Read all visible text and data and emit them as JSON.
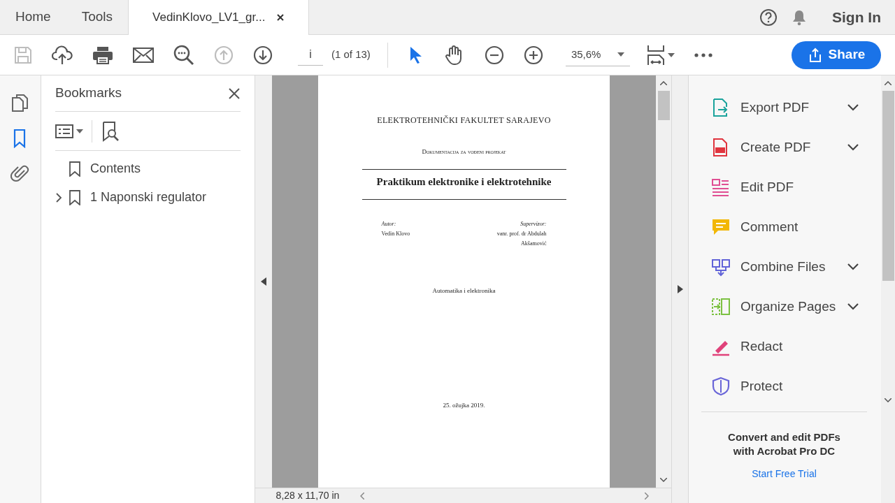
{
  "tabs": [
    {
      "label": "Home",
      "selected": false,
      "closable": false
    },
    {
      "label": "Tools",
      "selected": false,
      "closable": false
    },
    {
      "label": "VedinKlovo_LV1_gr...",
      "selected": true,
      "closable": true
    }
  ],
  "header": {
    "sign_in": "Sign In"
  },
  "toolbar": {
    "tools": [
      {
        "kind": "save",
        "disabled": true
      },
      {
        "kind": "upload",
        "disabled": false
      },
      {
        "kind": "print",
        "disabled": false
      },
      {
        "kind": "email",
        "disabled": false
      },
      {
        "kind": "find",
        "disabled": false
      },
      {
        "kind": "prev",
        "disabled": true
      },
      {
        "kind": "next",
        "disabled": false
      }
    ],
    "page_input": "i",
    "page_count": "(1 of 13)",
    "nav_tools": [
      {
        "kind": "select",
        "selected": true
      },
      {
        "kind": "hand",
        "selected": false
      },
      {
        "kind": "zoom-out",
        "selected": false
      },
      {
        "kind": "zoom-in",
        "selected": false
      }
    ],
    "zoom": "35,6%",
    "share": "Share"
  },
  "left_rail": [
    {
      "kind": "pages",
      "selected": false
    },
    {
      "kind": "bookmarks",
      "selected": true
    },
    {
      "kind": "attachments",
      "selected": false
    }
  ],
  "bookmarks": {
    "title": "Bookmarks",
    "items": [
      {
        "label": "Contents",
        "expandable": false
      },
      {
        "label": "1 Naponski regulator",
        "expandable": true,
        "expanded": false
      }
    ]
  },
  "document": {
    "institution": "ELEKTROTEHNIČKI FAKULTET SARAJEVO",
    "subtitle": "Dokumentacija za vođeni projekat",
    "title": "Praktikum elektronike i elektrotehnike",
    "author_label": "Autor:",
    "author": "Vedin Klovo",
    "supervisor_label": "Supervizor:",
    "supervisor": [
      "vanr. prof. dr Abdulah",
      "Akšamović"
    ],
    "program": "Automatika i elektronika",
    "date": "25. ožujka 2019."
  },
  "status": {
    "page_size": "8,28 x 11,70 in"
  },
  "tools_panel": {
    "items": [
      {
        "kind": "export",
        "label": "Export PDF",
        "has_menu": true,
        "color": "#1ba39c"
      },
      {
        "kind": "create",
        "label": "Create PDF",
        "has_menu": true,
        "color": "#e0343e"
      },
      {
        "kind": "edit",
        "label": "Edit PDF",
        "has_menu": false,
        "color": "#e04f93"
      },
      {
        "kind": "comment",
        "label": "Comment",
        "has_menu": false,
        "color": "#f2b705"
      },
      {
        "kind": "combine",
        "label": "Combine Files",
        "has_menu": true,
        "color": "#6264d8"
      },
      {
        "kind": "organize",
        "label": "Organize Pages",
        "has_menu": true,
        "color": "#7cc142"
      },
      {
        "kind": "redact",
        "label": "Redact",
        "has_menu": false,
        "color": "#e0427a"
      },
      {
        "kind": "protect",
        "label": "Protect",
        "has_menu": false,
        "color": "#6a66d8"
      }
    ],
    "promo": "Convert and edit PDFs with Acrobat Pro DC",
    "trial_link": "Start Free Trial"
  }
}
